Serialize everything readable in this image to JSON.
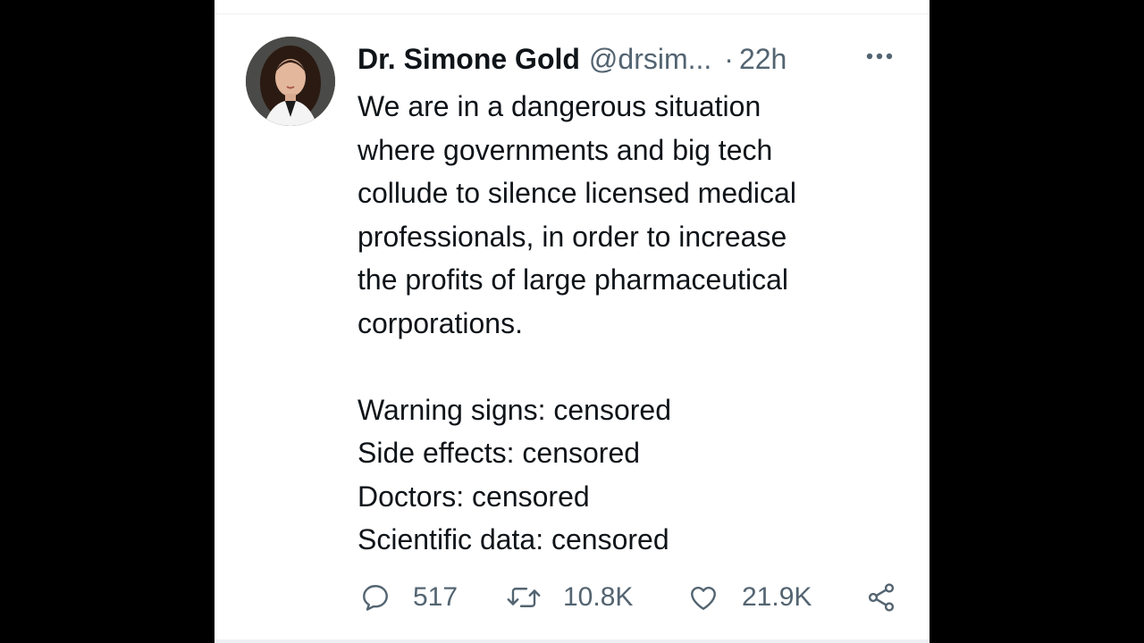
{
  "tweet": {
    "display_name": "Dr. Simone Gold",
    "handle": "@drsim...",
    "separator": "·",
    "timestamp": "22h",
    "lines": [
      "We are in a dangerous situation",
      "where governments and big tech",
      "collude to silence licensed medical",
      "professionals, in order to increase",
      "the profits of large pharmaceutical",
      "corporations.",
      "",
      "Warning signs: censored",
      "Side effects: censored",
      "Doctors: censored",
      "Scientific data: censored"
    ]
  },
  "actions": {
    "reply_count": "517",
    "retweet_count": "10.8K",
    "like_count": "21.9K"
  },
  "colors": {
    "text_primary": "#0f1419",
    "text_secondary": "#536471",
    "background": "#ffffff",
    "letterbox": "#000000"
  },
  "icons": [
    "more-icon",
    "reply-icon",
    "retweet-icon",
    "like-icon",
    "share-icon"
  ]
}
